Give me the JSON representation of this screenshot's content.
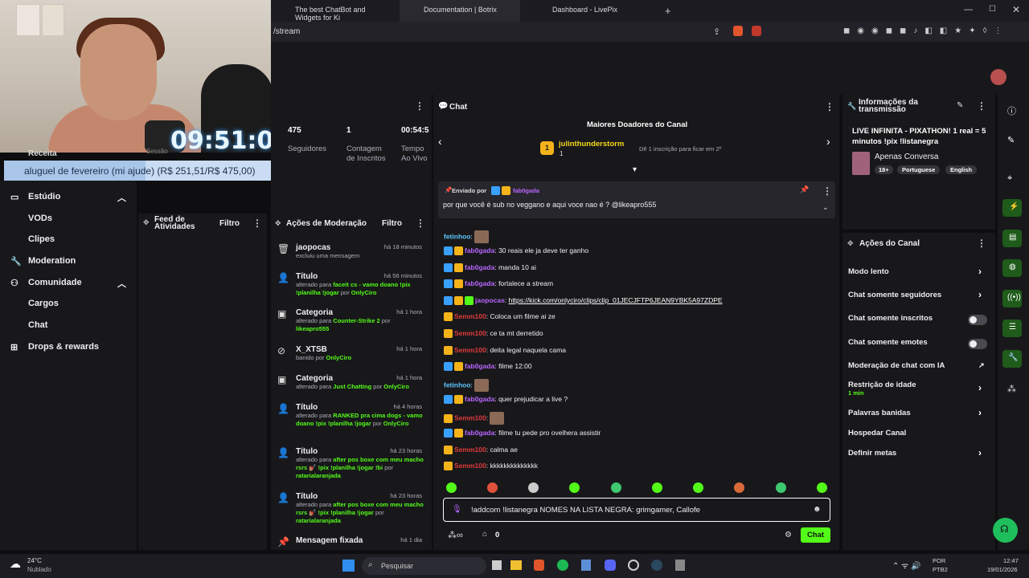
{
  "overlay": {
    "clock": "09:51:01",
    "donation": "aluguel de fevereiro (mi ajude) (R$ 251,51/R$ 475,00)",
    "donation_progress": 0.53
  },
  "browser": {
    "tabs": [
      "The best ChatBot and Widgets for Ki",
      "Documentation | Botrix",
      "Dashboard - LivePix"
    ],
    "url_fragment": "/stream",
    "new_tab": "+"
  },
  "stats": {
    "items": [
      {
        "value": "475",
        "label": "Seguidores"
      },
      {
        "value": "1",
        "label": "Contagem de Inscritos"
      },
      {
        "value": "00:54:5",
        "label": "Tempo Ao Vivo"
      }
    ],
    "partial_labels": [
      "Receita",
      "Sessão"
    ]
  },
  "nav": {
    "items": [
      {
        "label": "Estúdio",
        "icon": "monitor-icon"
      },
      {
        "label": "VODs"
      },
      {
        "label": "Clipes"
      },
      {
        "label": "Moderation",
        "icon": "wrench-icon"
      },
      {
        "label": "Comunidade",
        "icon": "people-icon"
      },
      {
        "label": "Cargos"
      },
      {
        "label": "Chat"
      },
      {
        "label": "Drops & rewards",
        "icon": "gift-icon"
      }
    ]
  },
  "feed": {
    "title": "Feed de Atividades",
    "filter": "Filtro"
  },
  "mod": {
    "title": "Ações de Moderação",
    "filter": "Filtro",
    "rows": [
      {
        "icon": "trash-icon",
        "title": "jaopocas",
        "time": "há 18 minutos",
        "sub": "excluiu uma mensagem"
      },
      {
        "icon": "user-edit-icon",
        "title": "Título",
        "time": "há 56 minutos",
        "sub_pre": "alterado para ",
        "sub_hl": "faceit cs - vamo doano !pix !planilha !jogar",
        "sub_mid": " por ",
        "sub_user": "OnlyCiro"
      },
      {
        "icon": "category-icon",
        "title": "Categoria",
        "time": "há 1 hora",
        "sub_pre": "alterado para ",
        "sub_hl": "Counter-Strike 2",
        "sub_mid": " por ",
        "sub_user": "likeapro555"
      },
      {
        "icon": "ban-icon",
        "title": "X_XTSB",
        "time": "há 1 hora",
        "sub_pre": "banido por ",
        "sub_hl": "",
        "sub_mid": "",
        "sub_user": "OnlyCiro"
      },
      {
        "icon": "category-icon",
        "title": "Categoria",
        "time": "há 1 hora",
        "sub_pre": "alterado para ",
        "sub_hl": "Just Chatting",
        "sub_mid": " por ",
        "sub_user": "OnlyCiro"
      },
      {
        "icon": "user-edit-icon",
        "title": "Título",
        "time": "há 4 horas",
        "sub_pre": "alterado para ",
        "sub_hl": "RANKED pra cima dogs - vamo doano !pix !planilha !jogar",
        "sub_mid": " por ",
        "sub_user": "OnlyCiro"
      },
      {
        "icon": "user-edit-icon",
        "title": "Título",
        "time": "há 23 horas",
        "sub_pre": "alterado para ",
        "sub_hl": "after pos boxe com meu macho rsrs 💅🏽 !pix !planilha !jogar !bi",
        "sub_mid": " por ",
        "sub_user": "ratarialaranjada"
      },
      {
        "icon": "user-edit-icon",
        "title": "Título",
        "time": "há 23 horas",
        "sub_pre": "alterado para ",
        "sub_hl": "after pos boxe com meu macho rsrs 💅🏽 !pix !planilha !jogar",
        "sub_mid": " por ",
        "sub_user": "ratarialaranjada"
      },
      {
        "icon": "pin-icon",
        "title": "Mensagem fixada",
        "time": "há 1 dia"
      }
    ]
  },
  "chat": {
    "title": "Chat",
    "donors_title": "Maiores Doadores do Canal",
    "donor_rank": "1",
    "donor_name": "julinthunderstorm",
    "donor_count": "1",
    "donor_hint": "Dê 1 inscrição para ficar em 2º",
    "pinned_by": "Enviado por",
    "pinned_user": "fab0gada",
    "pinned_text": "por que você é sub no veggano e aqui voce nao é ? @likeapro555",
    "messages": [
      {
        "user": "fetinhoo",
        "cls": "u-b",
        "badges": [],
        "text": "",
        "sticker": true
      },
      {
        "user": "fab0gada",
        "cls": "u-p",
        "badges": [
          "b1",
          "b2"
        ],
        "text": "30 reais ele ja deve ter ganho"
      },
      {
        "user": "fab0gada",
        "cls": "u-p",
        "badges": [
          "b1",
          "b2"
        ],
        "text": "manda 10 ai"
      },
      {
        "user": "fab0gada",
        "cls": "u-p",
        "badges": [
          "b1",
          "b2"
        ],
        "text": "fortalece a stream"
      },
      {
        "user": "jaopocas",
        "cls": "u-p",
        "badges": [
          "b1",
          "b2",
          "b3"
        ],
        "text": "https://kick.com/onlyciro/clips/clip_01JECJFTP6JEAN9YBK5A97ZDPE",
        "link": true
      },
      {
        "user": "Semm100",
        "cls": "u-r",
        "badges": [
          "b2"
        ],
        "text": "Coloca um filme ai ze"
      },
      {
        "user": "Semm100",
        "cls": "u-r",
        "badges": [
          "b2"
        ],
        "text": "ce ta mt derretido"
      },
      {
        "user": "Semm100",
        "cls": "u-r",
        "badges": [
          "b2"
        ],
        "text": "deita legal naquela cama"
      },
      {
        "user": "fab0gada",
        "cls": "u-p",
        "badges": [
          "b1",
          "b2"
        ],
        "text": "filme 12:00"
      },
      {
        "user": "fetinhoo",
        "cls": "u-b",
        "badges": [],
        "text": "",
        "sticker": true
      },
      {
        "user": "fab0gada",
        "cls": "u-p",
        "badges": [
          "b1",
          "b2"
        ],
        "text": "quer prejudicar a live ?"
      },
      {
        "user": "Semm100",
        "cls": "u-r",
        "badges": [
          "b2"
        ],
        "text": "",
        "sticker": true
      },
      {
        "user": "fab0gada",
        "cls": "u-p",
        "badges": [
          "b1",
          "b2"
        ],
        "text": "filme tu pede pro ovelhera assistir"
      },
      {
        "user": "Semm100",
        "cls": "u-r",
        "badges": [
          "b2"
        ],
        "text": "calma ae"
      },
      {
        "user": "Semm100",
        "cls": "u-r",
        "badges": [
          "b2"
        ],
        "text": "kkkkkkkkkkkkkk"
      }
    ],
    "input_value": "!addcom !listanegra NOMES NA LISTA NEGRA: grimgamer, Callofe",
    "points": "0",
    "send": "Chat"
  },
  "info": {
    "title": "Informações da transmissão",
    "stream_title": "LIVE INFINITA - PIXATHON! 1 real = 5 minutos !pix !listanegra",
    "category": "Apenas Conversa",
    "tags": [
      "18+",
      "Portuguese",
      "English"
    ]
  },
  "actions": {
    "title": "Ações do Canal",
    "rows": [
      {
        "label": "Modo lento",
        "type": "chevron"
      },
      {
        "label": "Chat somente seguidores",
        "type": "chevron"
      },
      {
        "label": "Chat somente inscritos",
        "type": "toggle"
      },
      {
        "label": "Chat somente emotes",
        "type": "toggle"
      },
      {
        "label": "Moderação de chat com IA",
        "type": "external"
      },
      {
        "label": "Restrição de idade",
        "sub": "1 min",
        "type": "chevron"
      },
      {
        "label": "Palavras banidas",
        "type": "chevron"
      },
      {
        "label": "Hospedar Canal",
        "type": "none"
      },
      {
        "label": "Definir metas",
        "type": "chevron"
      }
    ]
  },
  "taskbar": {
    "temp": "24°C",
    "weather": "Nublado",
    "search": "Pesquisar",
    "lang1": "POR",
    "lang2": "PTB2",
    "time": "12:47",
    "date": "19/01/2026"
  },
  "colors": {
    "accent": "#53fc18",
    "bg": "#0e0e10",
    "panel": "#18181b"
  }
}
